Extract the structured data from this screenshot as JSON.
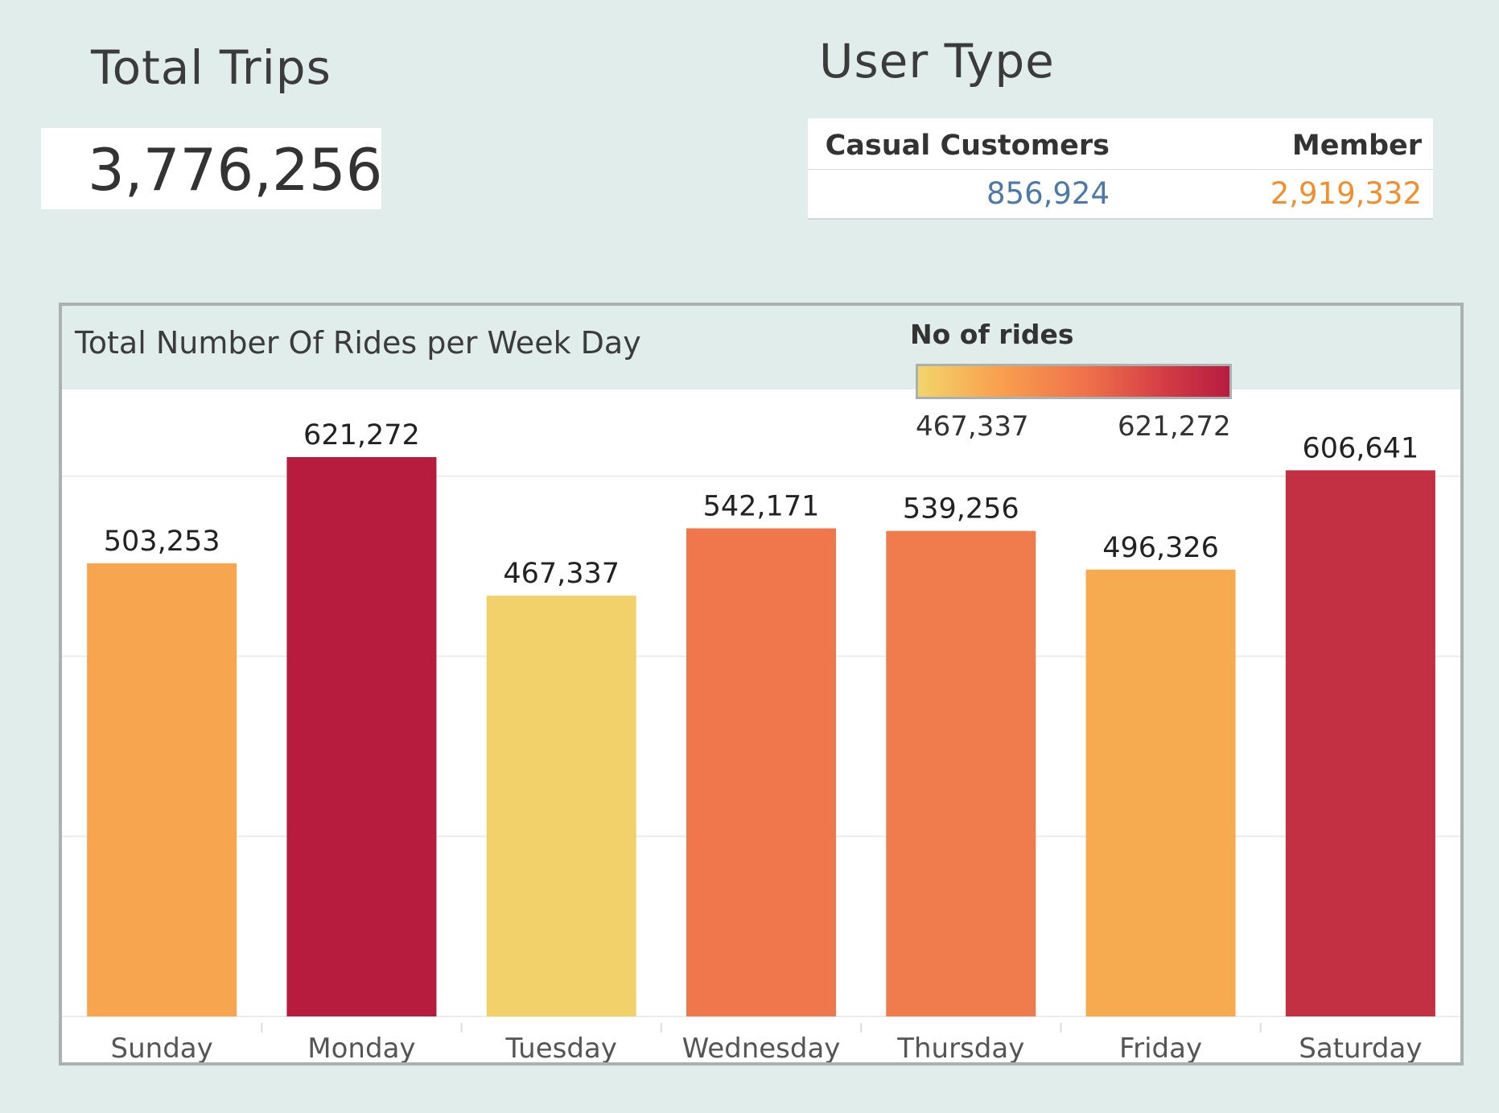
{
  "total_trips": {
    "title": "Total Trips",
    "value": "3,776,256"
  },
  "user_type": {
    "title": "User Type",
    "columns": [
      {
        "label": "Casual Customers",
        "value": "856,924",
        "color": "#4e79a7"
      },
      {
        "label": "Member",
        "value": "2,919,332",
        "color": "#f28e2b"
      }
    ]
  },
  "legend": {
    "title": "No of rides",
    "min_label": "467,337",
    "max_label": "621,272",
    "colors": [
      "#f2d56b",
      "#f9a24f",
      "#ef6f4a",
      "#d33a45",
      "#b71c3e"
    ]
  },
  "chart_data": {
    "type": "bar",
    "title": "Total Number Of Rides per Week Day",
    "xlabel": "",
    "ylabel": "",
    "categories": [
      "Sunday",
      "Monday",
      "Tuesday",
      "Wednesday",
      "Thursday",
      "Friday",
      "Saturday"
    ],
    "values": [
      503253,
      621272,
      467337,
      542171,
      539256,
      496326,
      606641
    ],
    "value_labels": [
      "503,253",
      "621,272",
      "467,337",
      "542,171",
      "539,256",
      "496,326",
      "606,641"
    ],
    "colors": [
      "#f8a54f",
      "#b71c3e",
      "#f2d06a",
      "#ef774b",
      "#f07b4c",
      "#f7ab51",
      "#c32f43"
    ],
    "ylim": [
      0,
      700000
    ],
    "gridlines": [
      0,
      200000,
      400000,
      600000
    ],
    "grid": true,
    "legend_position": "top-right"
  }
}
